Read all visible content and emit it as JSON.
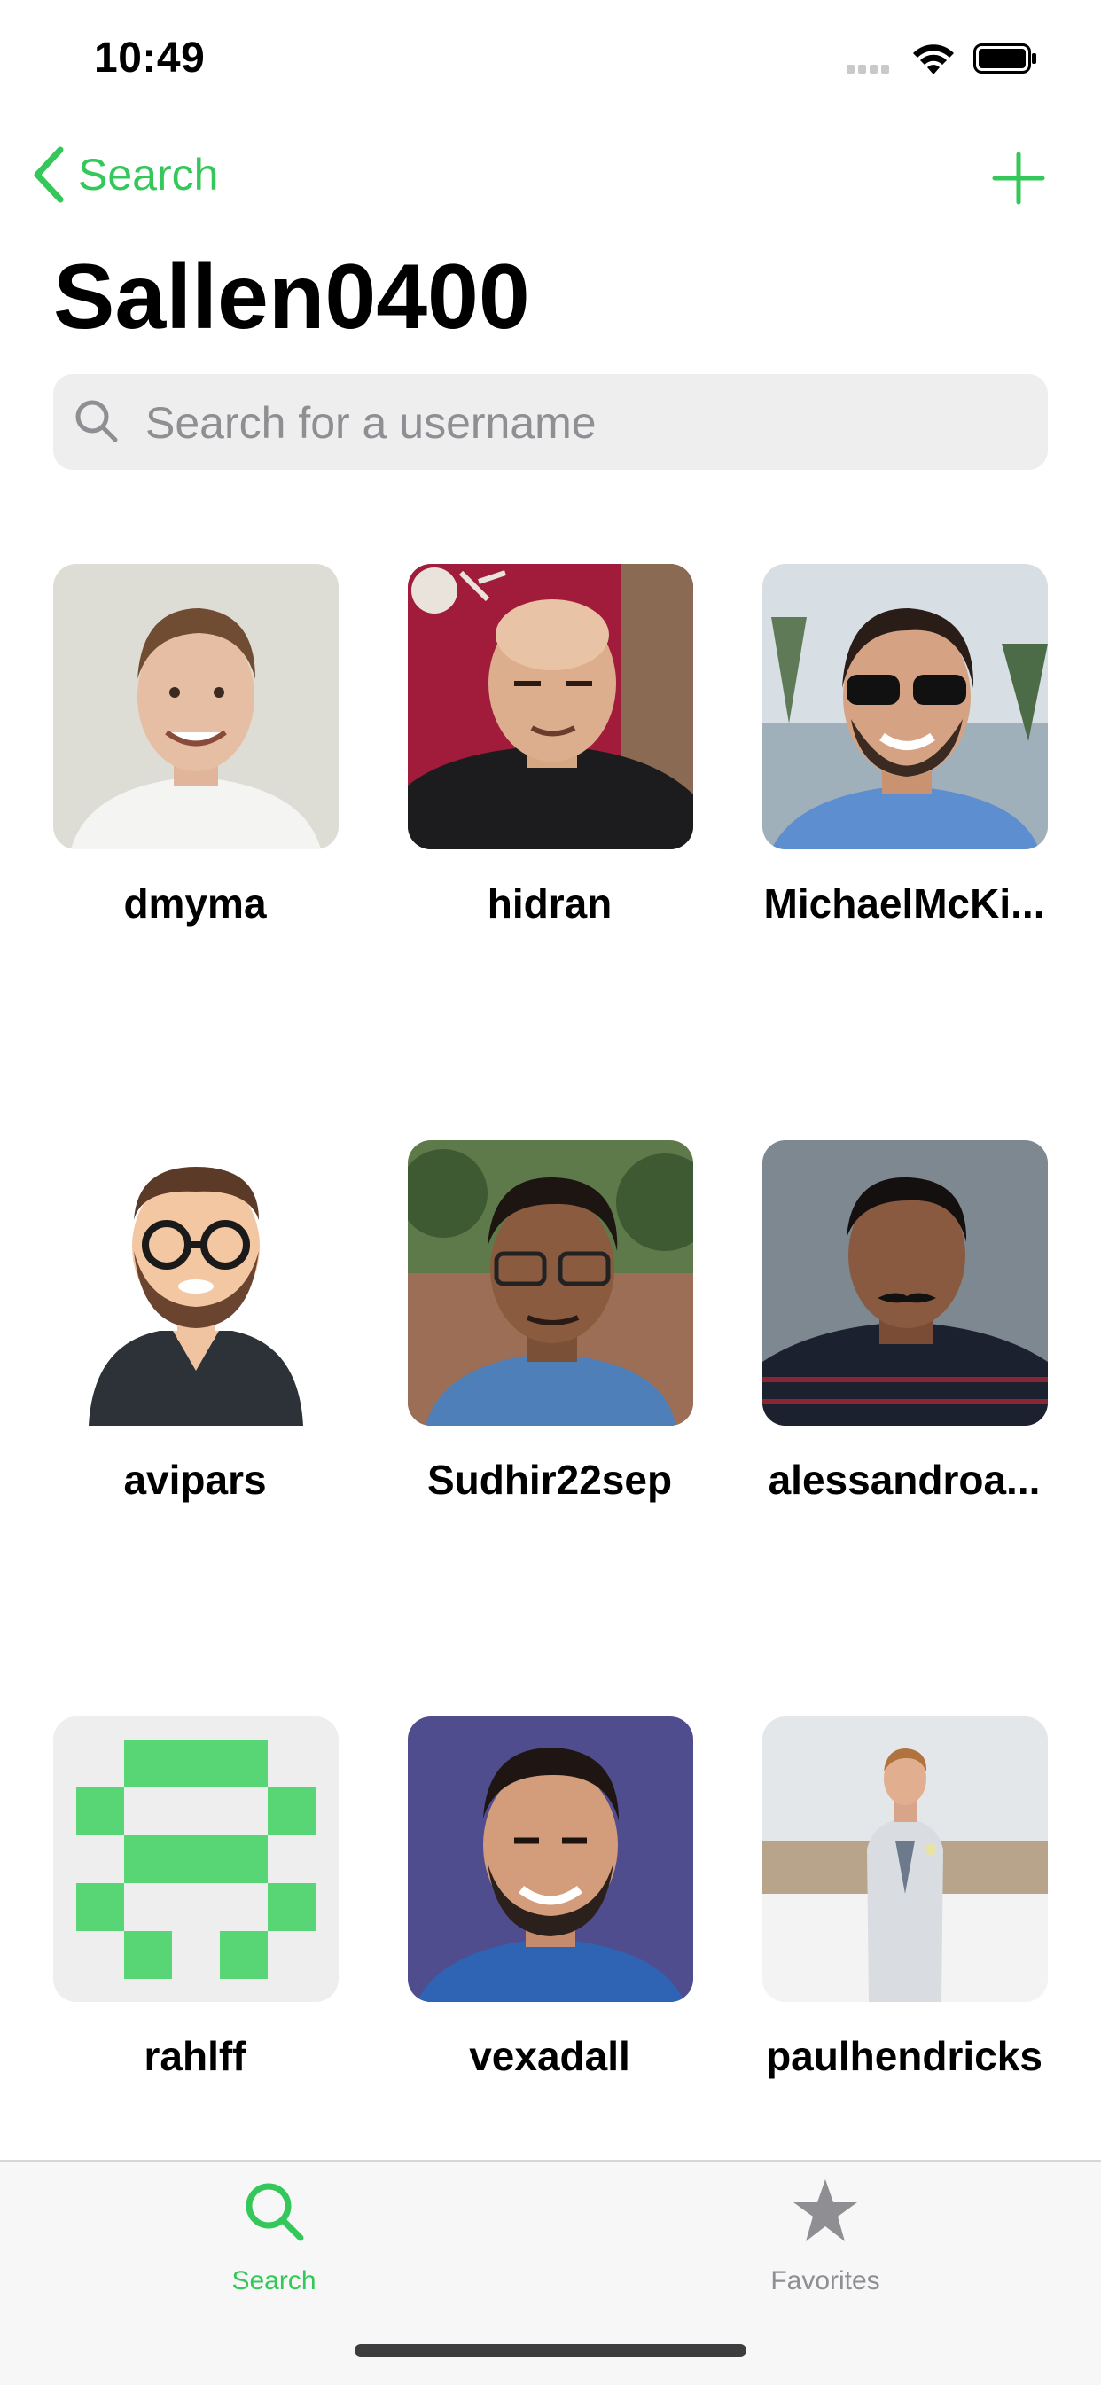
{
  "status": {
    "time": "10:49"
  },
  "nav": {
    "back_label": "Search"
  },
  "title": "Sallen0400",
  "search": {
    "placeholder": "Search for a username",
    "value": ""
  },
  "followers": [
    {
      "username": "dmyma"
    },
    {
      "username": "hidran"
    },
    {
      "username": "MichaelMcKi..."
    },
    {
      "username": "avipars"
    },
    {
      "username": "Sudhir22sep"
    },
    {
      "username": "alessandroa..."
    },
    {
      "username": "rahlff"
    },
    {
      "username": "vexadall"
    },
    {
      "username": "paulhendricks"
    }
  ],
  "tabs": [
    {
      "label": "Search",
      "icon": "search-icon",
      "active": true
    },
    {
      "label": "Favorites",
      "icon": "star-icon",
      "active": false
    }
  ],
  "colors": {
    "accent": "#34c759",
    "inactive": "#8e8e93"
  }
}
